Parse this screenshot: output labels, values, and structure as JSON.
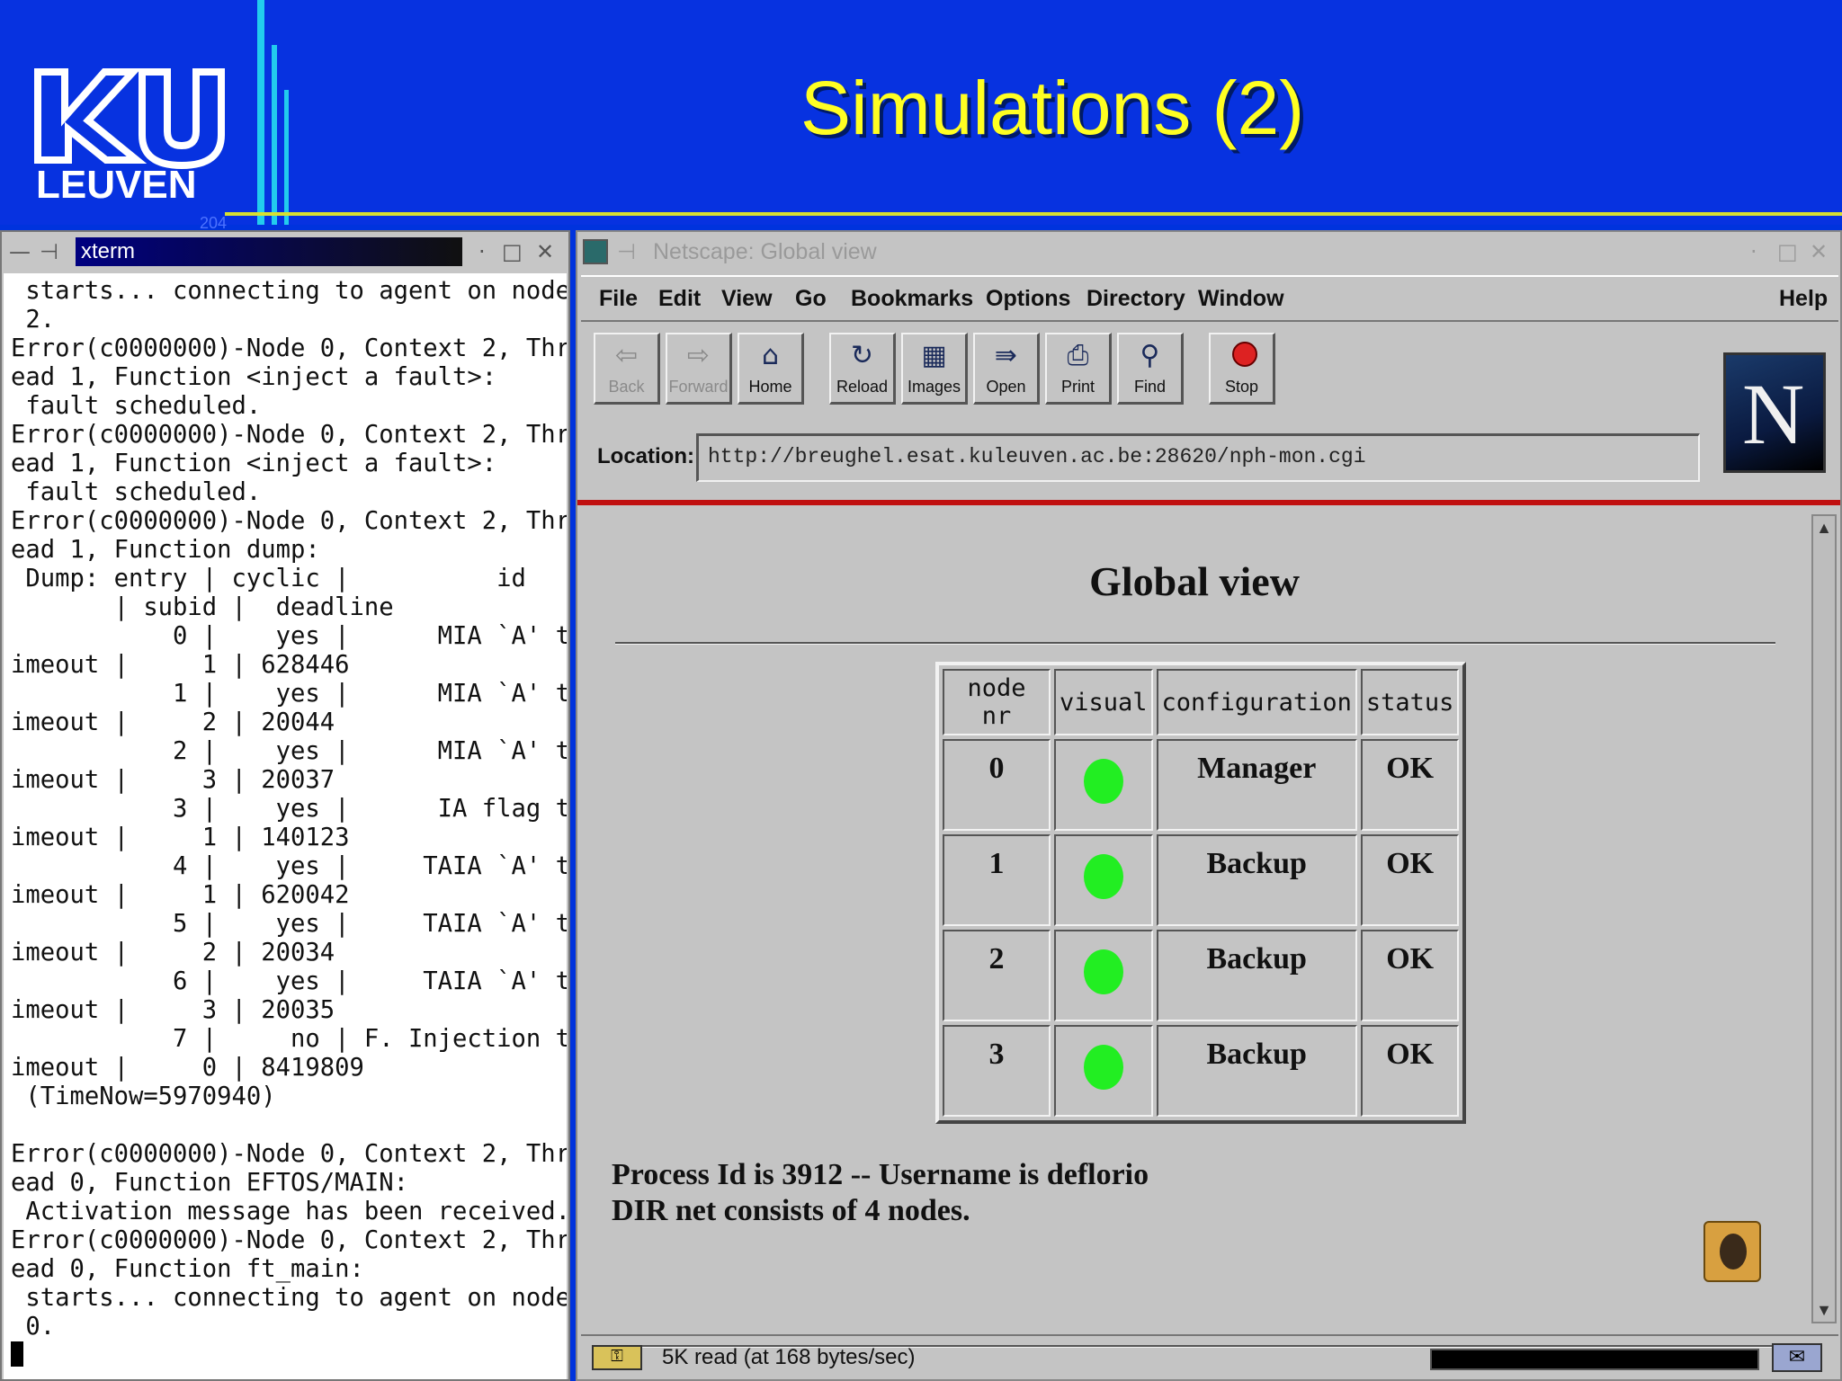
{
  "slide": {
    "title": "Simulations (2)",
    "logo_text": "LEUVEN",
    "slide_number": "204"
  },
  "xterm": {
    "title": "xterm",
    "lines": [
      " starts... connecting to agent on node",
      " 2.",
      "Error(c0000000)-Node 0, Context 2, Thr",
      "ead 1, Function <inject a fault>:",
      " fault scheduled.",
      "Error(c0000000)-Node 0, Context 2, Thr",
      "ead 1, Function <inject a fault>:",
      " fault scheduled.",
      "Error(c0000000)-Node 0, Context 2, Thr",
      "ead 1, Function dump:",
      " Dump: entry | cyclic |          id",
      "       | subid |  deadline",
      "           0 |    yes |      MIA `A' t",
      "imeout |     1 | 628446",
      "           1 |    yes |      MIA `A' t",
      "imeout |     2 | 20044",
      "           2 |    yes |      MIA `A' t",
      "imeout |     3 | 20037",
      "           3 |    yes |      IA flag t",
      "imeout |     1 | 140123",
      "           4 |    yes |     TAIA `A' t",
      "imeout |     1 | 620042",
      "           5 |    yes |     TAIA `A' t",
      "imeout |     2 | 20034",
      "           6 |    yes |     TAIA `A' t",
      "imeout |     3 | 20035",
      "           7 |     no | F. Injection t",
      "imeout |     0 | 8419809",
      " (TimeNow=5970940)",
      "",
      "Error(c0000000)-Node 0, Context 2, Thr",
      "ead 0, Function EFTOS/MAIN:",
      " Activation message has been received.",
      "Error(c0000000)-Node 0, Context 2, Thr",
      "ead 0, Function ft_main:",
      " starts... connecting to agent on node",
      " 0."
    ]
  },
  "netscape": {
    "window_title": "Netscape: Global view",
    "menu": {
      "file": "File",
      "edit": "Edit",
      "view": "View",
      "go": "Go",
      "bookmarks": "Bookmarks",
      "options": "Options",
      "directory": "Directory",
      "window": "Window",
      "help": "Help"
    },
    "toolbar": {
      "back": "Back",
      "forward": "Forward",
      "home": "Home",
      "reload": "Reload",
      "images": "Images",
      "open": "Open",
      "print": "Print",
      "find": "Find",
      "stop": "Stop"
    },
    "location_label": "Location:",
    "url": "http://breughel.esat.kuleuven.ac.be:28620/nph-mon.cgi",
    "logo_letter": "N",
    "page": {
      "heading": "Global view",
      "columns": [
        "node nr",
        "visual",
        "configuration",
        "status"
      ],
      "rows": [
        {
          "node": "0",
          "visual": "green",
          "configuration": "Manager",
          "status": "OK"
        },
        {
          "node": "1",
          "visual": "green",
          "configuration": "Backup",
          "status": "OK"
        },
        {
          "node": "2",
          "visual": "green",
          "configuration": "Backup",
          "status": "OK"
        },
        {
          "node": "3",
          "visual": "green",
          "configuration": "Backup",
          "status": "OK"
        }
      ],
      "process_line": "Process Id is 3912 -- Username is deflorio",
      "net_line": "DIR net consists of 4 nodes."
    },
    "status_text": "5K read (at 168 bytes/sec)"
  },
  "icons": {
    "pin": "pin-icon",
    "minimize": "minimize-icon",
    "maximize": "maximize-icon",
    "close": "close-icon",
    "back": "back-arrow-icon",
    "forward": "forward-arrow-icon",
    "home": "house-icon",
    "reload": "reload-icon",
    "images": "images-icon",
    "open": "open-icon",
    "print": "printer-icon",
    "find": "binoculars-icon",
    "stop": "stop-sign-icon",
    "security": "key-icon",
    "mail": "mail-icon"
  },
  "colors": {
    "slide_background": "#0732e0",
    "slide_title": "#ffff22",
    "status_ok_dot": "#22ee22",
    "accent_redline": "#c01010"
  }
}
